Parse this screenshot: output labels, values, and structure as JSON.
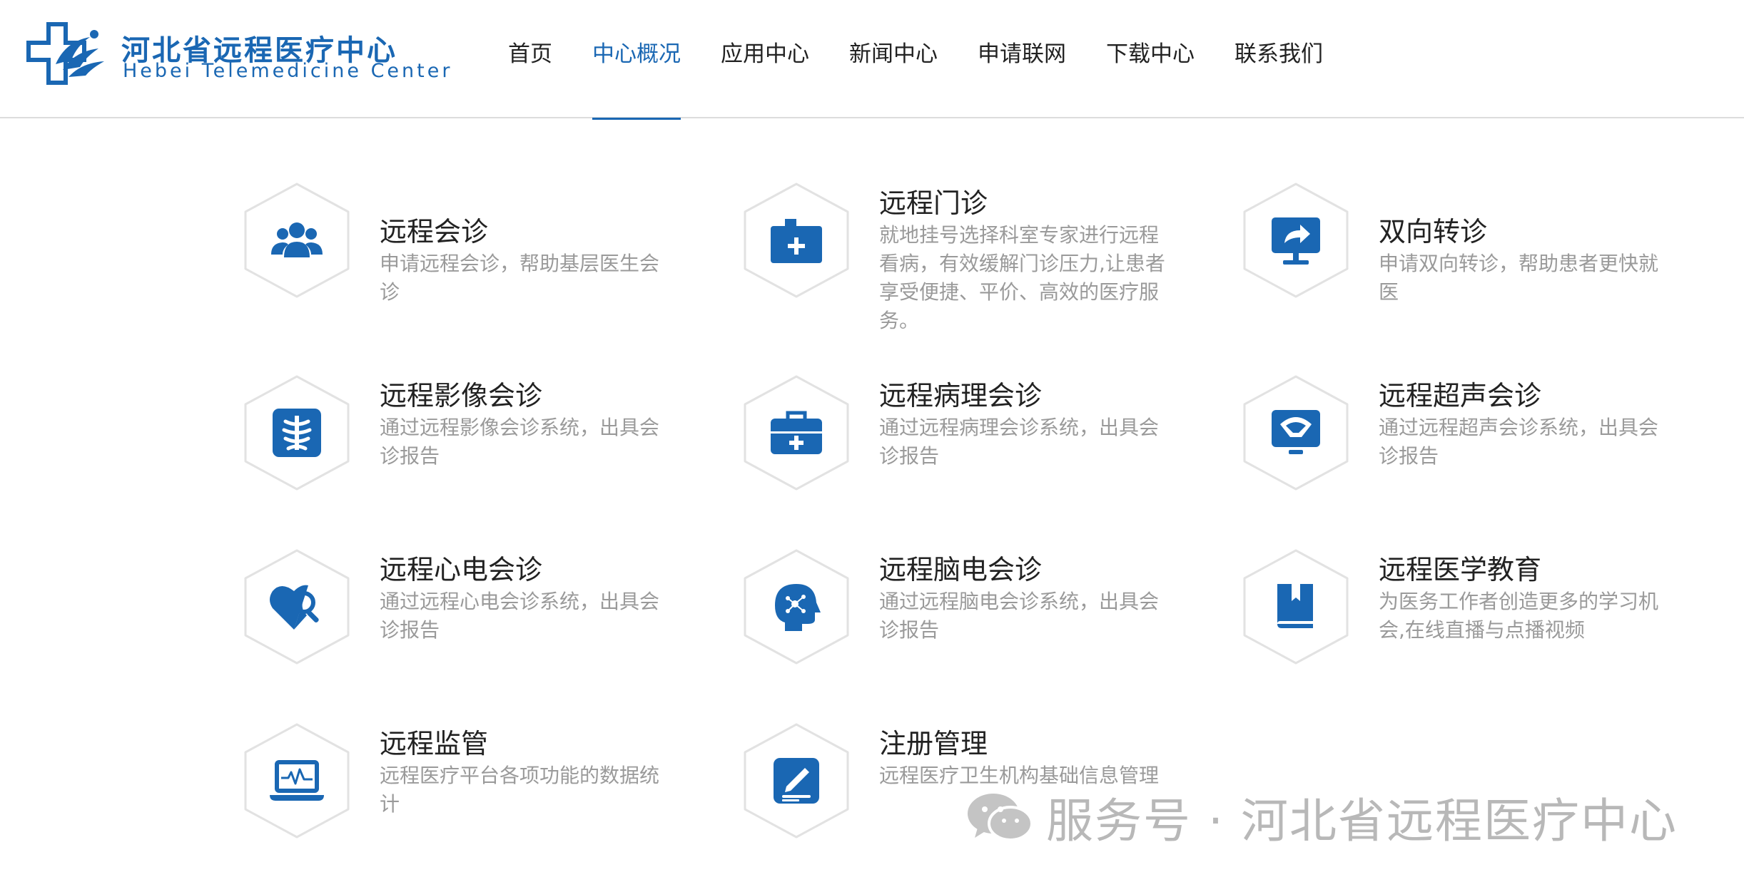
{
  "header": {
    "logo_cn": "河北省远程医疗中心",
    "logo_en": "Hebei Telemedicine Center",
    "nav": [
      {
        "label": "首页",
        "active": false
      },
      {
        "label": "中心概况",
        "active": true
      },
      {
        "label": "应用中心",
        "active": false
      },
      {
        "label": "新闻中心",
        "active": false
      },
      {
        "label": "申请联网",
        "active": false
      },
      {
        "label": "下载中心",
        "active": false
      },
      {
        "label": "联系我们",
        "active": false
      }
    ]
  },
  "services": [
    {
      "title": "远程会诊",
      "desc": "申请远程会诊，帮助基层医生会诊",
      "icon": "group-users-icon"
    },
    {
      "title": "远程门诊",
      "desc": "就地挂号选择科室专家进行远程看病，有效缓解门诊压力,让患者享受便捷、平价、高效的医疗服务。",
      "icon": "medical-box-icon"
    },
    {
      "title": "双向转诊",
      "desc": "申请双向转诊，帮助患者更快就医",
      "icon": "monitor-share-icon"
    },
    {
      "title": "远程影像会诊",
      "desc": "通过远程影像会诊系统，出具会诊报告",
      "icon": "xray-icon"
    },
    {
      "title": "远程病理会诊",
      "desc": "通过远程病理会诊系统，出具会诊报告",
      "icon": "medical-kit-icon"
    },
    {
      "title": "远程超声会诊",
      "desc": "通过远程超声会诊系统，出具会诊报告",
      "icon": "ultrasound-monitor-icon"
    },
    {
      "title": "远程心电会诊",
      "desc": "通过远程心电会诊系统，出具会诊报告",
      "icon": "heart-search-icon"
    },
    {
      "title": "远程脑电会诊",
      "desc": "通过远程脑电会诊系统，出具会诊报告",
      "icon": "brain-head-icon"
    },
    {
      "title": "远程医学教育",
      "desc": "为医务工作者创造更多的学习机会,在线直播与点播视频",
      "icon": "book-icon"
    },
    {
      "title": "远程监管",
      "desc": "远程医疗平台各项功能的数据统计",
      "icon": "laptop-pulse-icon"
    },
    {
      "title": "注册管理",
      "desc": "远程医疗卫生机构基础信息管理",
      "icon": "edit-document-icon"
    }
  ],
  "watermark": {
    "text": "服务号 · 河北省远程医疗中心",
    "icon": "wechat-icon"
  },
  "colors": {
    "brand": "#1a67b3",
    "text": "#222222",
    "muted": "#9a9a9a"
  }
}
